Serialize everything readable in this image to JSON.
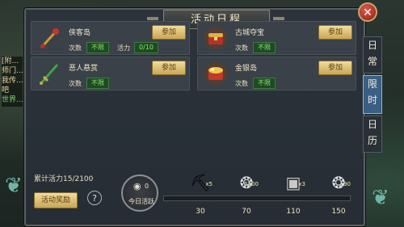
{
  "title": "活动日程",
  "close_symbol": "✕",
  "chat_lines": [
    "[附...",
    "师门...",
    "我传...",
    "吧",
    "世界..."
  ],
  "activities": [
    {
      "name": "侠客岛",
      "count_label": "次数",
      "count_value": "不限",
      "vitality_label": "活力",
      "vitality_value": "0/10",
      "join_label": "参加",
      "icon": "red-tassel-weapon-icon"
    },
    {
      "name": "古城夺宝",
      "count_label": "次数",
      "count_value": "不限",
      "join_label": "参加",
      "icon": "treasure-chest-icon"
    },
    {
      "name": "恶人悬赏",
      "count_label": "次数",
      "count_value": "不限",
      "join_label": "参加",
      "icon": "green-sword-icon"
    },
    {
      "name": "金银岛",
      "count_label": "次数",
      "count_value": "不限",
      "join_label": "参加",
      "icon": "gold-chest-icon"
    }
  ],
  "side_tabs": [
    {
      "label": "日常",
      "active": false
    },
    {
      "label": "限时",
      "active": true
    },
    {
      "label": "日历",
      "active": false
    }
  ],
  "total_vitality": "累计活力15/2100",
  "reward_button": "活动奖励",
  "help_symbol": "?",
  "daily": {
    "value": "0",
    "label": "今日活跃"
  },
  "progress": {
    "current": 0,
    "max": 150
  },
  "tiers": [
    {
      "threshold": "30",
      "count": "x5",
      "icon": "pickaxe-icon"
    },
    {
      "threshold": "70",
      "count": "5200",
      "icon": "silver-coins-icon"
    },
    {
      "threshold": "110",
      "count": "x3",
      "icon": "gift-box-icon"
    },
    {
      "threshold": "150",
      "count": "190",
      "icon": "silver-ingot-icon"
    }
  ],
  "colors": {
    "accent_gold": "#d8b55a",
    "tab_active": "#3a5f86",
    "value_green": "#8ee36a"
  }
}
